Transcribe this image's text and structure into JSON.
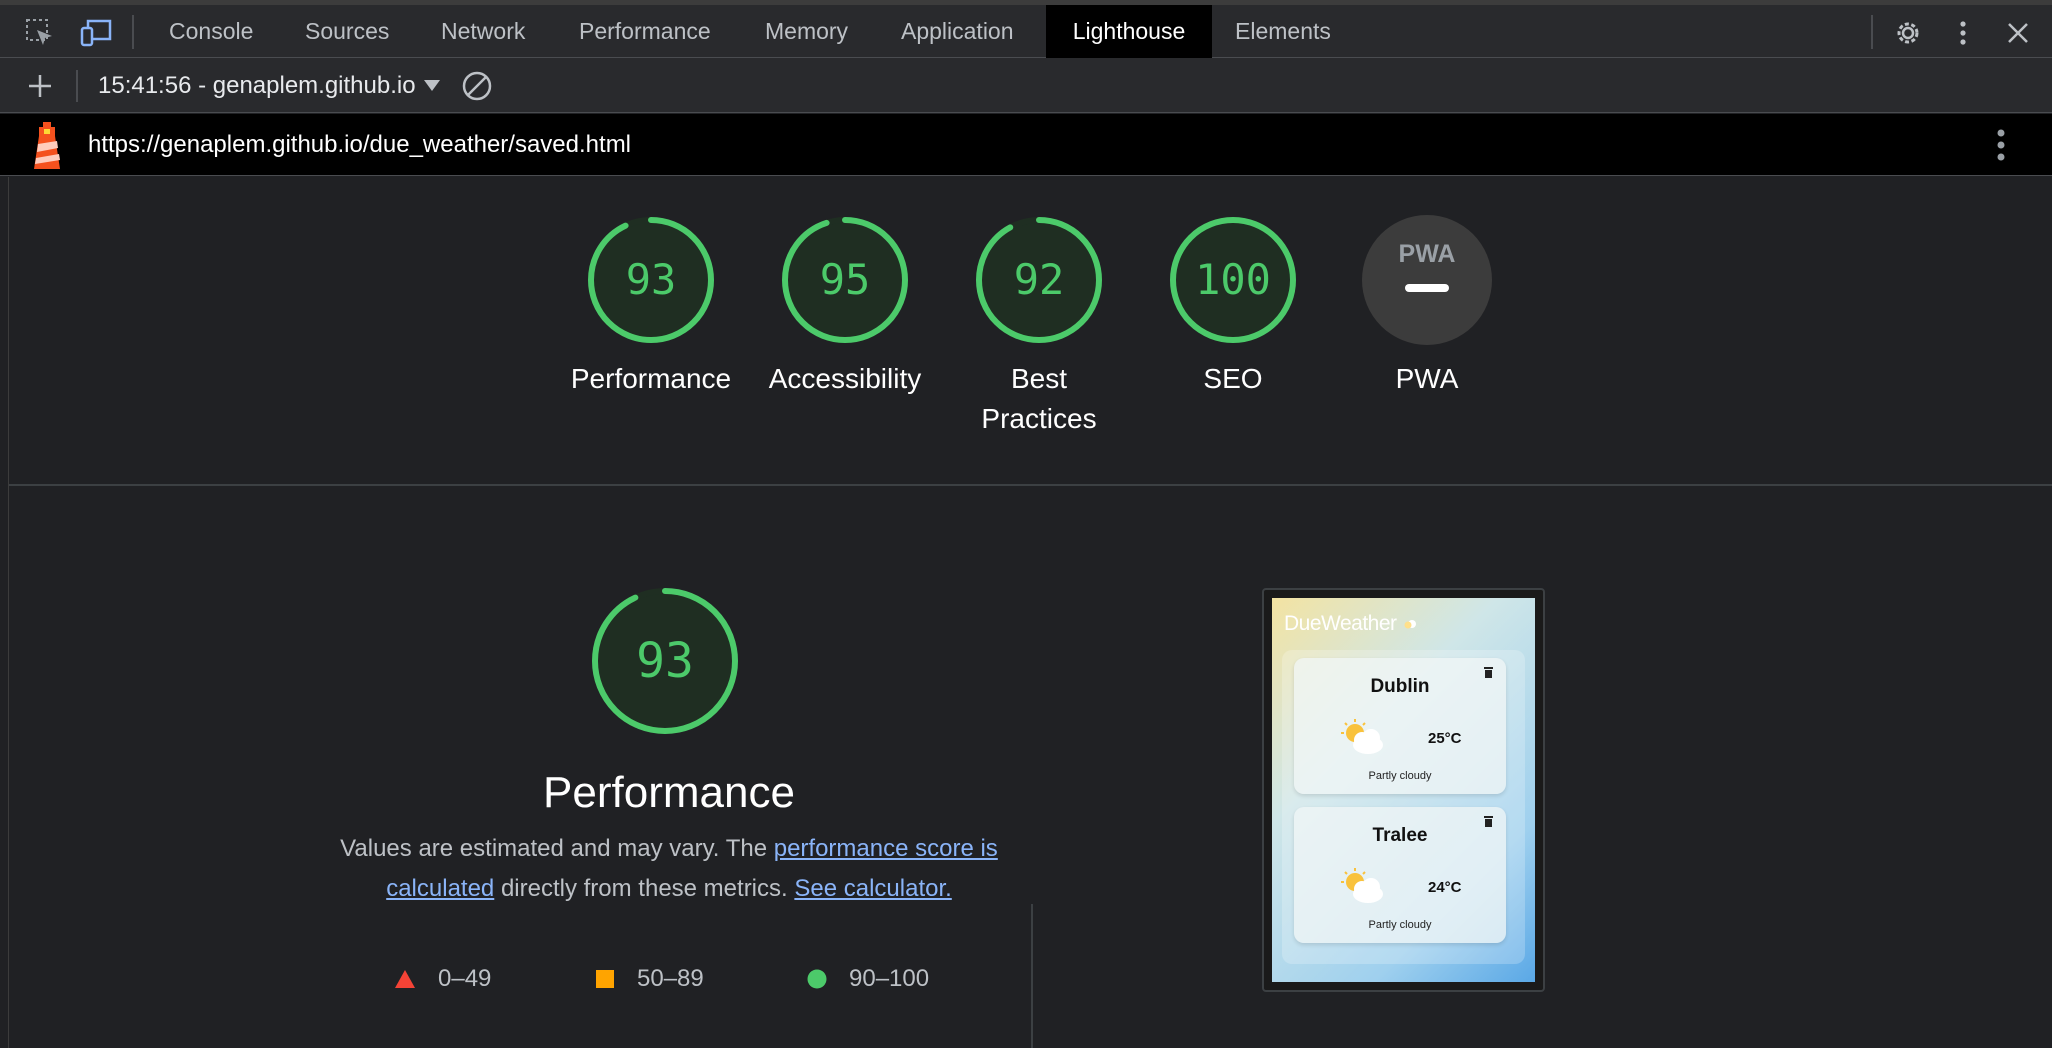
{
  "tabs": {
    "items": [
      {
        "label": "Console"
      },
      {
        "label": "Sources"
      },
      {
        "label": "Network"
      },
      {
        "label": "Performance"
      },
      {
        "label": "Memory"
      },
      {
        "label": "Application"
      },
      {
        "label": "Lighthouse"
      },
      {
        "label": "Elements"
      }
    ],
    "active": "Lighthouse"
  },
  "toolbar": {
    "report_label": "15:41:56 - genaplem.github.io"
  },
  "urlbar": {
    "url": "https://genaplem.github.io/due_weather/saved.html"
  },
  "gauges": [
    {
      "label": "Performance",
      "score": "93",
      "fraction": 0.93
    },
    {
      "label": "Accessibility",
      "score": "95",
      "fraction": 0.95
    },
    {
      "label": "Best Practices",
      "score": "92",
      "fraction": 0.92
    },
    {
      "label": "SEO",
      "score": "100",
      "fraction": 1.0
    },
    {
      "label": "PWA",
      "badge": "PWA"
    }
  ],
  "performance": {
    "score": "93",
    "fraction": 0.93,
    "title": "Performance",
    "desc_prefix": "Values are estimated and may vary. The ",
    "desc_link1": "performance score is calculated",
    "desc_middle": " directly from these metrics. ",
    "desc_link2": "See calculator.",
    "legend": [
      {
        "range": "0–49",
        "shape": "triangle",
        "color": "#f44336"
      },
      {
        "range": "50–89",
        "shape": "square",
        "color": "#ffa400"
      },
      {
        "range": "90–100",
        "shape": "circle",
        "color": "#4cca6a"
      }
    ]
  },
  "screenshot": {
    "brand": "DueWeather",
    "cities": [
      {
        "name": "Dublin",
        "temp": "25°C",
        "condition": "Partly cloudy"
      },
      {
        "name": "Tralee",
        "temp": "24°C",
        "condition": "Partly cloudy"
      }
    ]
  },
  "colors": {
    "pass": "#4cca6a",
    "pass_bg": "#1f2e22",
    "pwa_bg": "#3c3c3c"
  }
}
